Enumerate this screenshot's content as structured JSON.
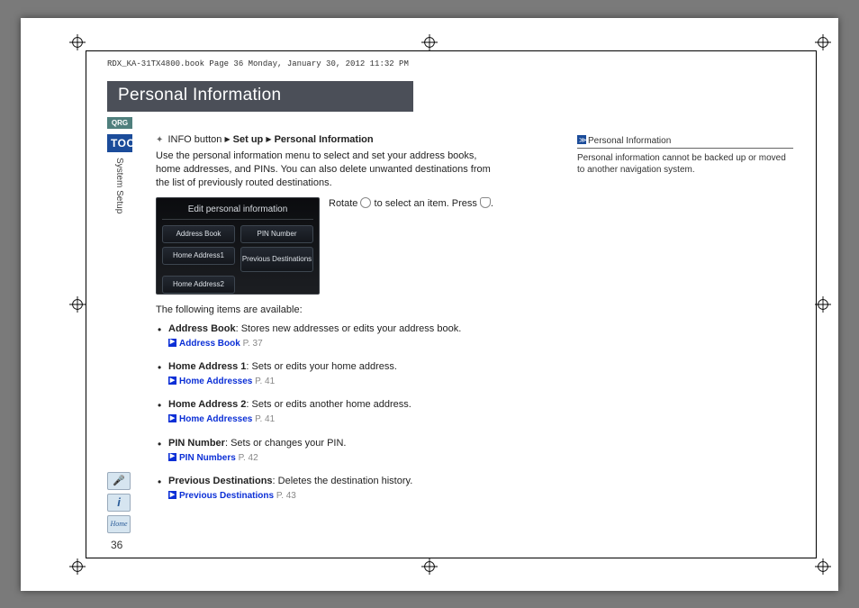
{
  "header_runner": "RDX_KA-31TX4800.book  Page 36  Monday, January 30, 2012  11:32 PM",
  "title": "Personal Information",
  "side": {
    "qrg": "QRG",
    "toc": "TOC",
    "section": "System Setup",
    "home_label": "Home"
  },
  "page_number": "36",
  "info_path": {
    "prefix": "INFO button",
    "step1": "Set up",
    "step2": "Personal Information"
  },
  "intro": "Use the personal information menu to select and set your address books, home addresses, and PINs. You can also delete unwanted destinations from the list of previously routed destinations.",
  "rotate_text_1": "Rotate ",
  "rotate_text_2": " to select an item. Press ",
  "rotate_text_3": ".",
  "screen": {
    "title": "Edit personal information",
    "buttons": {
      "b1": "Address Book",
      "b2": "PIN Number",
      "b3": "Home Address1",
      "b4": "Previous Destinations",
      "b5": "Home Address2"
    }
  },
  "items_intro": "The following items are available:",
  "items": [
    {
      "label": "Address Book",
      "desc": ": Stores new addresses or edits your address book.",
      "ref": "Address Book",
      "page": "P. 37"
    },
    {
      "label": "Home Address 1",
      "desc": ": Sets or edits your home address.",
      "ref": "Home Addresses",
      "page": "P. 41"
    },
    {
      "label": "Home Address 2",
      "desc": ": Sets or edits another home address.",
      "ref": "Home Addresses",
      "page": "P. 41"
    },
    {
      "label": "PIN Number",
      "desc": ": Sets or changes your PIN.",
      "ref": "PIN Numbers",
      "page": "P. 42"
    },
    {
      "label": "Previous Destinations",
      "desc": ": Deletes the destination history.",
      "ref": "Previous Destinations",
      "page": "P. 43"
    }
  ],
  "right": {
    "heading": "Personal Information",
    "body": "Personal information cannot be backed up or moved to another navigation system."
  }
}
